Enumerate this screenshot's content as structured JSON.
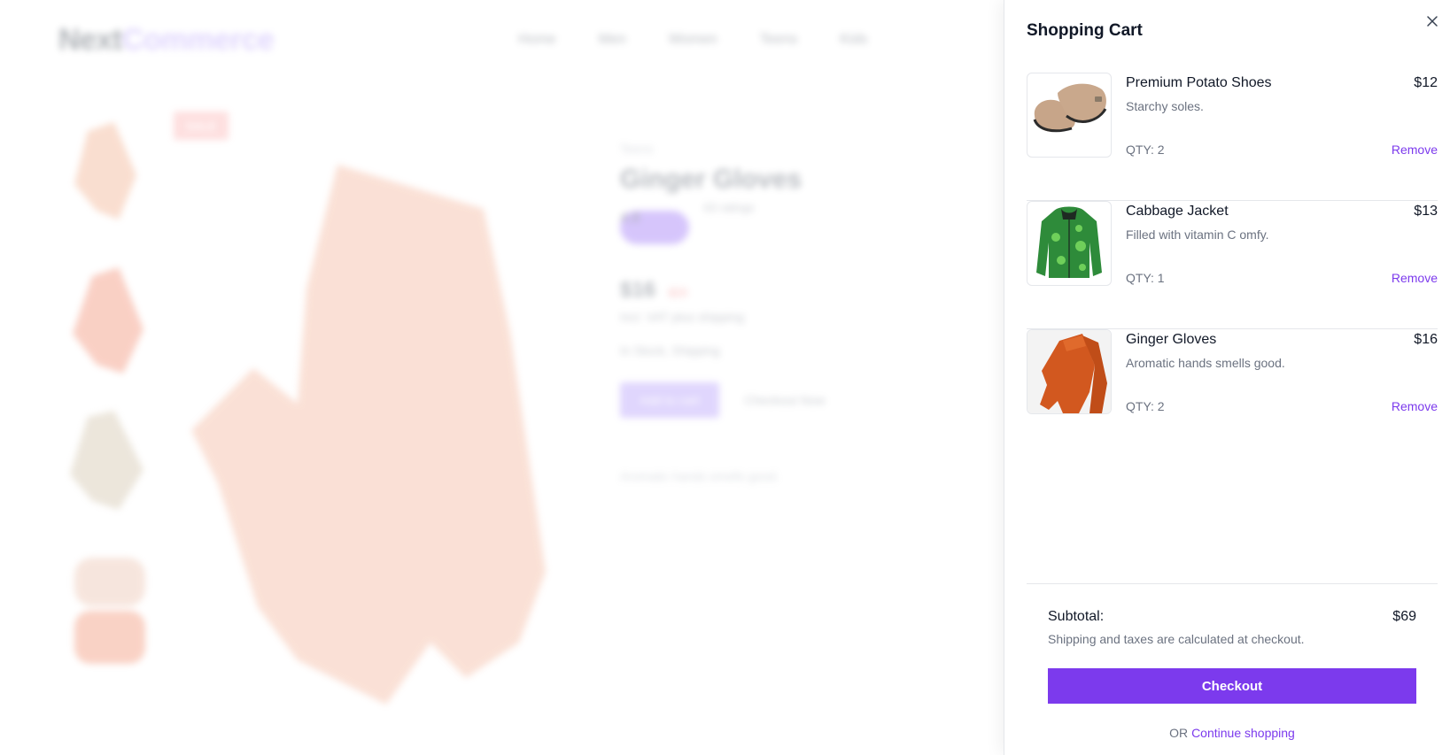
{
  "background": {
    "logo_part1": "Next",
    "logo_part2": "Commerce",
    "nav": [
      "Home",
      "Men",
      "Women",
      "Teens",
      "Kids"
    ],
    "badge": "SALE",
    "category": "Teens",
    "product_title": "Ginger Gloves",
    "rating_label": "4.8",
    "reviews": "63 ratings",
    "price": "$16",
    "old_price": "$20",
    "vat_note": "Incl. VAT plus shipping",
    "shipping_note": "In Stock, Shipping",
    "add_to_cart": "Add to cart",
    "secondary_link": "Checkout Now",
    "description": "Aromatic hands smells good."
  },
  "cart": {
    "title": "Shopping Cart",
    "close_label": "×",
    "items": [
      {
        "name": "Premium Potato Shoes",
        "desc": "Starchy soles.",
        "qty": "QTY: 2",
        "price": "$12",
        "remove": "Remove",
        "image": "clog-shoe"
      },
      {
        "name": "Cabbage Jacket",
        "desc": "Filled with vitamin C omfy.",
        "qty": "QTY: 1",
        "price": "$13",
        "remove": "Remove",
        "image": "green-jacket"
      },
      {
        "name": "Ginger Gloves",
        "desc": "Aromatic hands smells good.",
        "qty": "QTY: 2",
        "price": "$16",
        "remove": "Remove",
        "image": "orange-gloves"
      }
    ],
    "subtotal_label": "Subtotal:",
    "subtotal_value": "$69",
    "shipping_note": "Shipping and taxes are calculated at checkout.",
    "checkout_label": "Checkout",
    "or_label": "OR",
    "continue_label": "Continue shopping"
  },
  "colors": {
    "accent": "#7c3aed",
    "text": "#111827",
    "muted": "#6b7280",
    "border": "#e5e7eb"
  }
}
